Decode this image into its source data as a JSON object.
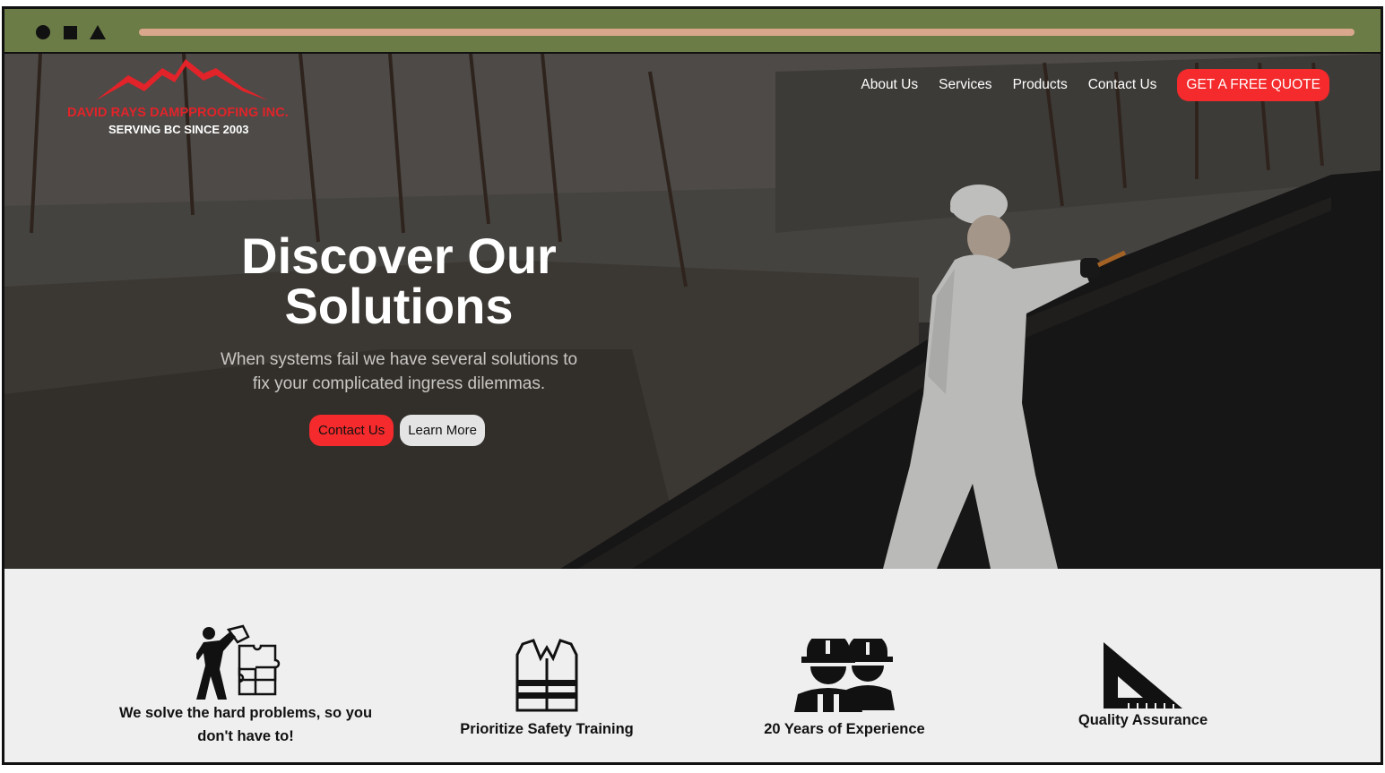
{
  "chrome": {
    "controls": [
      "circle",
      "square",
      "triangle"
    ],
    "accent_color": "#6b7c46",
    "address_bar_color": "#d9a88c"
  },
  "logo": {
    "brand": "DAVID RAYS DAMPPROOFING INC.",
    "tagline": "SERVING BC SINCE 2003",
    "icon": "mountain-logo-icon",
    "brand_color": "#e2232a"
  },
  "nav": {
    "items": [
      {
        "label": "About Us"
      },
      {
        "label": "Services"
      },
      {
        "label": "Products"
      },
      {
        "label": "Contact Us"
      }
    ],
    "cta": "GET A FREE QUOTE"
  },
  "hero": {
    "title_line1": "Discover Our",
    "title_line2": "Solutions",
    "subtitle_line1": "When systems fail we have several solutions to",
    "subtitle_line2": "fix your complicated ingress dilemmas.",
    "primary_button": "Contact Us",
    "secondary_button": "Learn More",
    "accent_color": "#f42a2c"
  },
  "features": [
    {
      "icon": "puzzle-worker-icon",
      "line1": "We solve the hard problems, so you",
      "line2": "don't have to!"
    },
    {
      "icon": "safety-vest-icon",
      "line1": "Prioritize Safety Training"
    },
    {
      "icon": "construction-workers-icon",
      "line1": "20 Years of Experience"
    },
    {
      "icon": "carpenter-square-icon",
      "line1": "Quality Assurance"
    }
  ]
}
